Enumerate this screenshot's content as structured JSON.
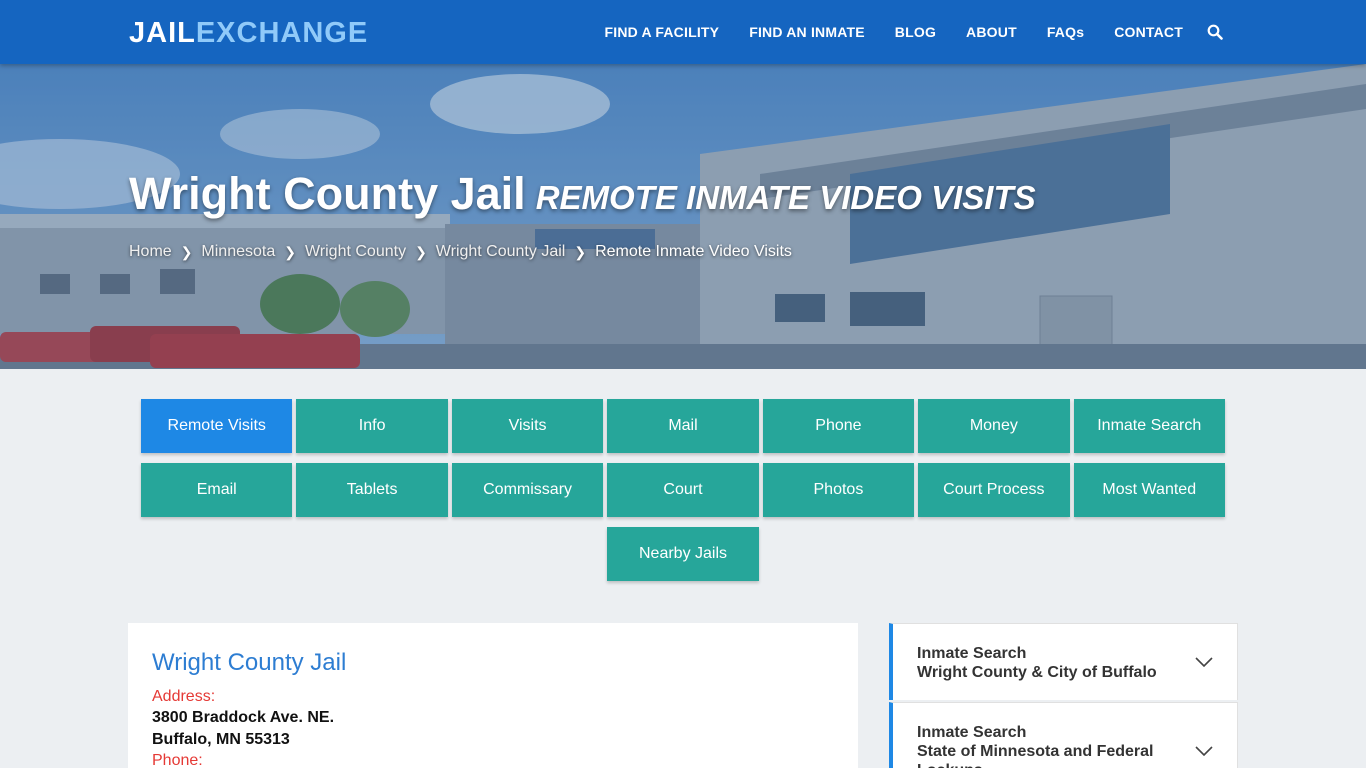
{
  "header": {
    "logo_part1": "JAIL",
    "logo_part2": "EXCHANGE",
    "nav": [
      "FIND A FACILITY",
      "FIND AN INMATE",
      "BLOG",
      "ABOUT",
      "FAQs",
      "CONTACT"
    ],
    "icons": {
      "search": "search-icon"
    },
    "colors": {
      "bar": "#1565c0",
      "logo_accent": "#90caf9"
    }
  },
  "hero": {
    "title": "Wright County Jail",
    "subtitle": "Remote Inmate Video Visits",
    "breadcrumbs": [
      "Home",
      "Minnesota",
      "Wright County",
      "Wright County Jail",
      "Remote Inmate Video Visits"
    ]
  },
  "buttons": {
    "row1": [
      "Remote Visits",
      "Info",
      "Visits",
      "Mail",
      "Phone",
      "Money",
      "Inmate Search"
    ],
    "row2": [
      "Email",
      "Tablets",
      "Commissary",
      "Court",
      "Photos",
      "Court Process",
      "Most Wanted"
    ],
    "row3": [
      "Nearby Jails"
    ],
    "active": "Remote Visits",
    "colors": {
      "default": "#26a69a",
      "active": "#1e88e5"
    }
  },
  "facility": {
    "name": "Wright County Jail",
    "address_label": "Address:",
    "address_line1": "3800 Braddock Ave. NE.",
    "address_line2": "Buffalo, MN 55313",
    "phone_label": "Phone:"
  },
  "sidebar": {
    "items": [
      {
        "title": "Inmate Search",
        "subtitle": "Wright County & City of Buffalo"
      },
      {
        "title": "Inmate Search",
        "subtitle": "State of Minnesota and Federal Lockups"
      }
    ]
  }
}
